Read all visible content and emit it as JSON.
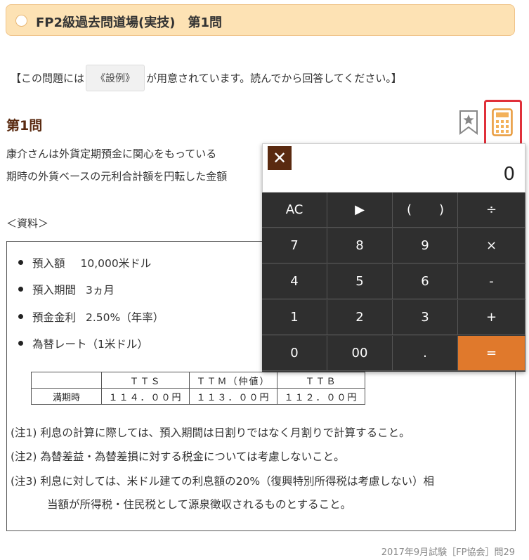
{
  "header": {
    "title": "FP2級過去問道場(実技)　第1問"
  },
  "notice": {
    "pre": "【この問題には",
    "button": "《設例》",
    "post": "が用意されています。読んでから回答してください。】"
  },
  "question": {
    "heading": "第1問",
    "line1": "康介さんは外貨定期預金に関心をもっている",
    "line2": "期時の外貨ベースの元利合計額を円転した金額"
  },
  "material": {
    "label": "＜資料＞",
    "items": [
      {
        "label": "預入額",
        "value": "10,000米ドル"
      },
      {
        "label": "預入期間",
        "value": "3ヵ月"
      },
      {
        "label": "預金金利",
        "value": "2.50%（年率）"
      },
      {
        "label": "為替レート（1米ドル）",
        "value": ""
      }
    ],
    "table": {
      "headers": [
        "",
        "ＴＴＳ",
        "ＴＴＭ（仲値）",
        "ＴＴＢ"
      ],
      "row": [
        "満期時",
        "１１４．００円",
        "１１３．００円",
        "１１２．００円"
      ]
    },
    "notes": [
      "(注1) 利息の計算に際しては、預入期間は日割りではなく月割りで計算すること。",
      "(注2) 為替差益・為替差損に対する税金については考慮しないこと。",
      "(注3) 利息に対しては、米ドル建ての利息額の20%（復興特別所得税は考慮しない）相"
    ],
    "note3_cont": "当額が所得税・住民税として源泉徴収されるものとすること。"
  },
  "source": "2017年9月試験［FP協会］問29",
  "calculator": {
    "close": "✕",
    "display": "0",
    "keys": {
      "ac": "AC",
      "play": "▶",
      "lparen": "(",
      "rparen": ")",
      "div": "÷",
      "k7": "7",
      "k8": "8",
      "k9": "9",
      "mul": "×",
      "k4": "4",
      "k5": "5",
      "k6": "6",
      "sub": "-",
      "k1": "1",
      "k2": "2",
      "k3": "3",
      "add": "+",
      "k0": "0",
      "k00": "00",
      "dot": ".",
      "eq": "="
    }
  },
  "icons": {
    "star": "star-bookmark-icon",
    "calculator": "calculator-icon"
  },
  "colors": {
    "accent": "#e0792c",
    "title_bg": "#fde2b4",
    "heading": "#5a2a10",
    "highlight": "#e0303a"
  }
}
